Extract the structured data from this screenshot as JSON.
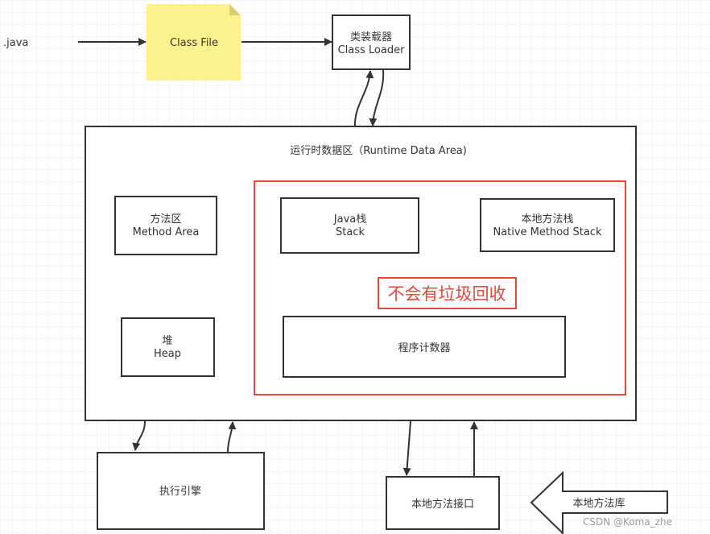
{
  "source_label": ".java",
  "class_file": "Class File",
  "class_loader": {
    "cn": "类装载器",
    "en": "Class Loader"
  },
  "runtime_area": {
    "title": "运行时数据区（Runtime Data Area)"
  },
  "method_area": {
    "cn": "方法区",
    "en": "Method Area"
  },
  "java_stack": {
    "cn": "Java栈",
    "en": "Stack"
  },
  "native_stack": {
    "cn": "本地方法栈",
    "en": "Native Method Stack"
  },
  "no_gc_note": "不会有垃圾回收",
  "heap": {
    "cn": "堆",
    "en": "Heap"
  },
  "program_counter": "程序计数器",
  "execution_engine": "执行引擎",
  "native_interface": "本地方法接口",
  "native_library": "本地方法库",
  "watermark": "CSDN @Koma_zhe",
  "colors": {
    "note_yellow": "#fbf28f",
    "highlight_red": "#e8483c",
    "line": "#333333"
  }
}
